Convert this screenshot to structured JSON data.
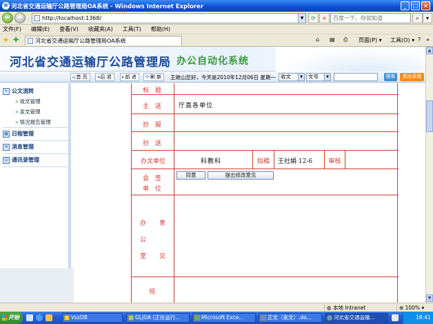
{
  "window": {
    "title": "河北省交通运输厅公路管理局OA系统 - Windows Internet Explorer",
    "min_label": "_",
    "max_label": "□",
    "close_label": "×"
  },
  "browser": {
    "back_label": "←",
    "forward_label": "→",
    "address": "http://localhost:1368/",
    "search_placeholder": "百度一下，你就知道",
    "refresh_label": "⟳",
    "stop_label": "×",
    "menu": [
      "文件(F)",
      "编辑(E)",
      "查看(V)",
      "收藏夹(A)",
      "工具(T)",
      "帮助(H)"
    ],
    "tab_title": "河北省交通运输厅公路管理局OA系统",
    "cmd_page": "页面(P) ▾",
    "cmd_tools": "工具(O) ▾",
    "cmd_home": "⌂",
    "cmd_print": "⎙",
    "cmd_feeds": "▤",
    "cmd_help": "?",
    "cmd_more": "»"
  },
  "app": {
    "title_main": "河北省交通运输厅公路管理局",
    "title_sub": "办公自动化系统",
    "toolbar": {
      "home": "首 页",
      "back": "后 退",
      "forward": "前 进",
      "refresh": "刷 新",
      "greeting": "王继山您好，今天是2010年12月06日 星期一",
      "select1": "收文",
      "select2": "文号",
      "search_btn": "搜索",
      "logout_btn": "退出系统"
    },
    "sidebar": {
      "sections": [
        {
          "label": "公文流转",
          "subs": [
            "收文管理",
            "发文管理",
            "情况报告管理"
          ]
        },
        {
          "label": "日程管理",
          "subs": []
        },
        {
          "label": "消息管理",
          "subs": []
        },
        {
          "label": "通讯录管理",
          "subs": []
        }
      ]
    },
    "form": {
      "label_title": "标 题",
      "label_main_send": "主 送",
      "value_main_send": "厅直各单位",
      "label_cc1": "抄 报",
      "label_cc2": "抄 送",
      "label_office": "办文单位",
      "value_office": "科教科",
      "label_draft": "拟稿",
      "value_draft": "王社娟 12-6",
      "label_review": "审核",
      "label_countersign_1": "会 签",
      "label_countersign_2": "单 位",
      "btn_agree": "同意",
      "btn_suggest": "提出修改意见",
      "label_office_opinion_1": "办",
      "label_office_opinion_2": "意",
      "label_office_opinion_3": "公",
      "label_office_opinion_4": "室",
      "label_office_opinion_5": "见",
      "label_leader": "领"
    }
  },
  "statusbar": {
    "zone": "本地 Intranet",
    "zoom": "100%"
  },
  "taskbar": {
    "start": "开始",
    "tasks": [
      "VssDB",
      "GLJOA (正在运行...",
      "Microsoft Exce...",
      "正文（发文）.do...",
      "河北省交通运输..."
    ],
    "clock": "18:41"
  }
}
